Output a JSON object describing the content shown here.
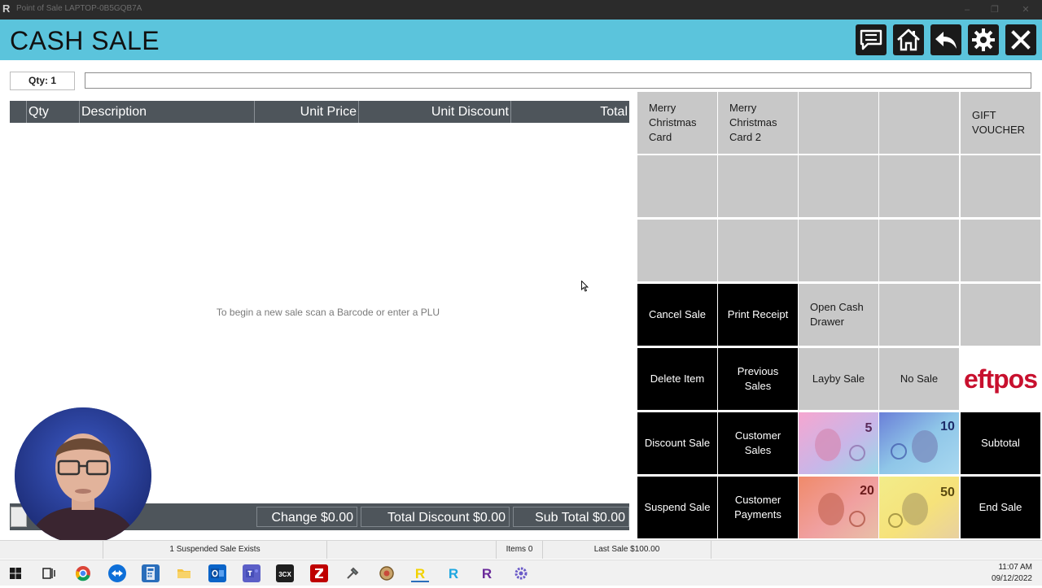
{
  "window": {
    "title": "Point of Sale LAPTOP-0B5GQB7A",
    "app_glyph": "R",
    "controls": [
      "–",
      "❐",
      "✕"
    ]
  },
  "header": {
    "title": "CASH SALE",
    "buttons": [
      "chat-icon",
      "home-icon",
      "back-icon",
      "settings-icon",
      "close-icon"
    ],
    "bg_color": "#5bc4dc"
  },
  "entry": {
    "qty_label": "Qty: 1",
    "plu_value": "",
    "plu_placeholder": ""
  },
  "grid": {
    "columns": [
      "Qty",
      "Description",
      "Unit Price",
      "Unit Discount",
      "Total"
    ],
    "rows": [],
    "empty_message": "To begin a new sale scan a Barcode or enter a PLU"
  },
  "totals": {
    "change": "Change $0.00",
    "total_discount": "Total Discount $0.00",
    "sub_total": "Sub Total $0.00"
  },
  "buttons": {
    "merry_christmas_card": "Merry Christmas Card",
    "merry_christmas_card_2": "Merry Christmas Card 2",
    "gift_voucher": "GIFT VOUCHER",
    "cancel_sale": "Cancel Sale",
    "print_receipt": "Print Receipt",
    "open_cash_drawer": "Open Cash Drawer",
    "delete_item": "Delete Item",
    "previous_sales": "Previous Sales",
    "layby_sale": "Layby Sale",
    "no_sale": "No Sale",
    "eftpos": "eftpos",
    "discount_sale": "Discount Sale",
    "customer_sales": "Customer Sales",
    "subtotal": "Subtotal",
    "suspend_sale": "Suspend Sale",
    "customer_payments": "Customer Payments",
    "end_sale": "End Sale",
    "notes": [
      "5",
      "10",
      "20",
      "50"
    ]
  },
  "status": {
    "suspended": "1 Suspended Sale Exists",
    "items": "Items 0",
    "last_sale": "Last Sale $100.00"
  },
  "taskbar": {
    "icons": [
      "windows-start-icon",
      "task-view-icon",
      "chrome-icon",
      "teamviewer-icon",
      "calculator-icon",
      "file-explorer-icon",
      "outlook-icon",
      "teams-icon",
      "3cx-icon",
      "filezilla-icon",
      "tool-icon",
      "app-icon",
      "r-yellow-icon",
      "r-blue-icon",
      "r-purple-icon",
      "settings-cog-icon"
    ],
    "time": "11:07 AM",
    "date": "09/12/2022"
  }
}
